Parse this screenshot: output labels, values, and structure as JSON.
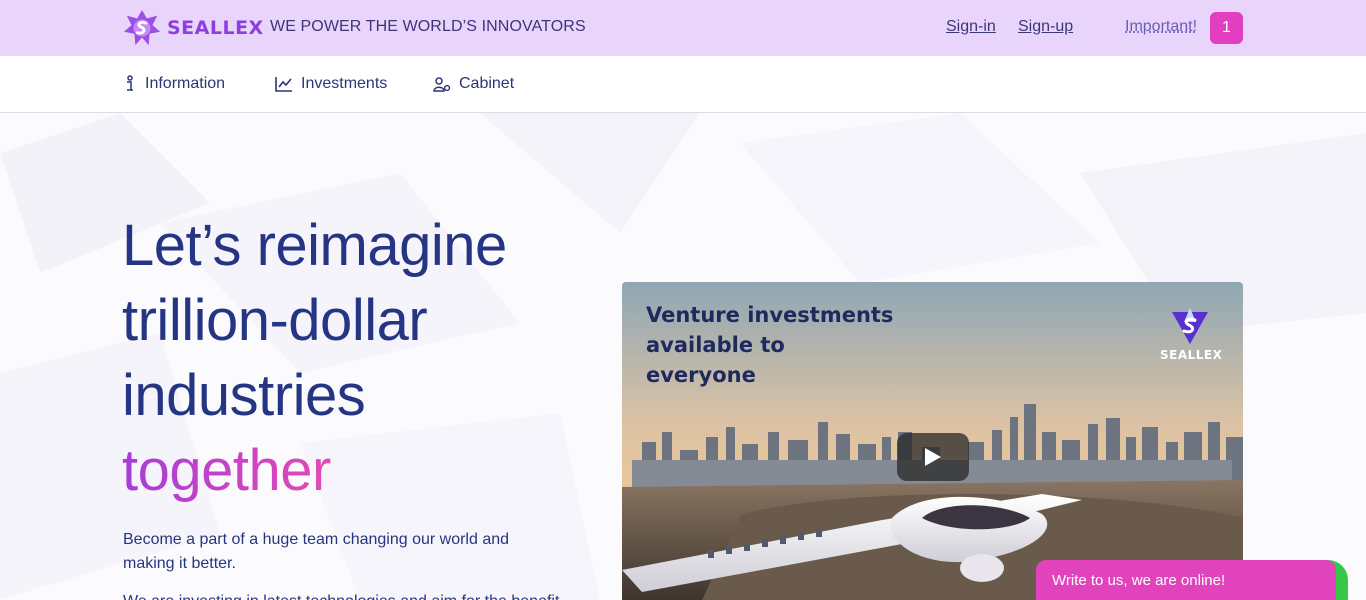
{
  "header": {
    "brand": "SEALLEX",
    "tagline": "WE POWER THE WORLD’S INNOVATORS",
    "signin": "Sign-in",
    "signup": "Sign-up",
    "important": "Important!",
    "badge_count": "1"
  },
  "nav": {
    "items": [
      {
        "label": "Information",
        "icon": "info-icon"
      },
      {
        "label": "Investments",
        "icon": "chart-line-icon"
      },
      {
        "label": "Cabinet",
        "icon": "user-gear-icon"
      }
    ]
  },
  "hero": {
    "line1": "Let’s reimagine",
    "line2": "trillion-dollar",
    "line3": "industries",
    "line4": "together",
    "description": "Become a part of a huge team changing our world and making it better.",
    "description_cut": "We are investing in latest technologies and aim for the benefit"
  },
  "video": {
    "caption_line1": "Venture investments",
    "caption_line2": "available to",
    "caption_line3": "everyone",
    "logo_text": "SEALLEX",
    "play_icon": "play-icon"
  },
  "chat": {
    "label": "Write to us, we are online!"
  },
  "colors": {
    "topbar": "#e9d4fc",
    "brand_purple": "#8d3ee0",
    "heading_navy": "#263583",
    "accent_pink": "#e23ec0",
    "online_green": "#37c84a"
  }
}
